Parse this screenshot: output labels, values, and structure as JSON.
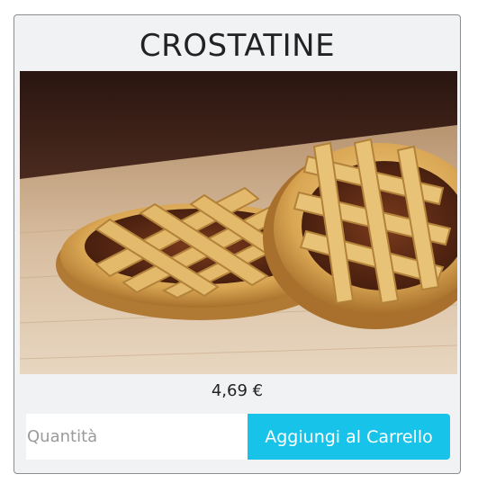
{
  "product": {
    "title": "CROSTATINE",
    "price": "4,69 €"
  },
  "cart_form": {
    "quantity_placeholder": "Quantità",
    "add_button_label": "Aggiungi al Carrello"
  },
  "colors": {
    "button": "#17c3e8",
    "card_background": "#f1f2f4"
  }
}
